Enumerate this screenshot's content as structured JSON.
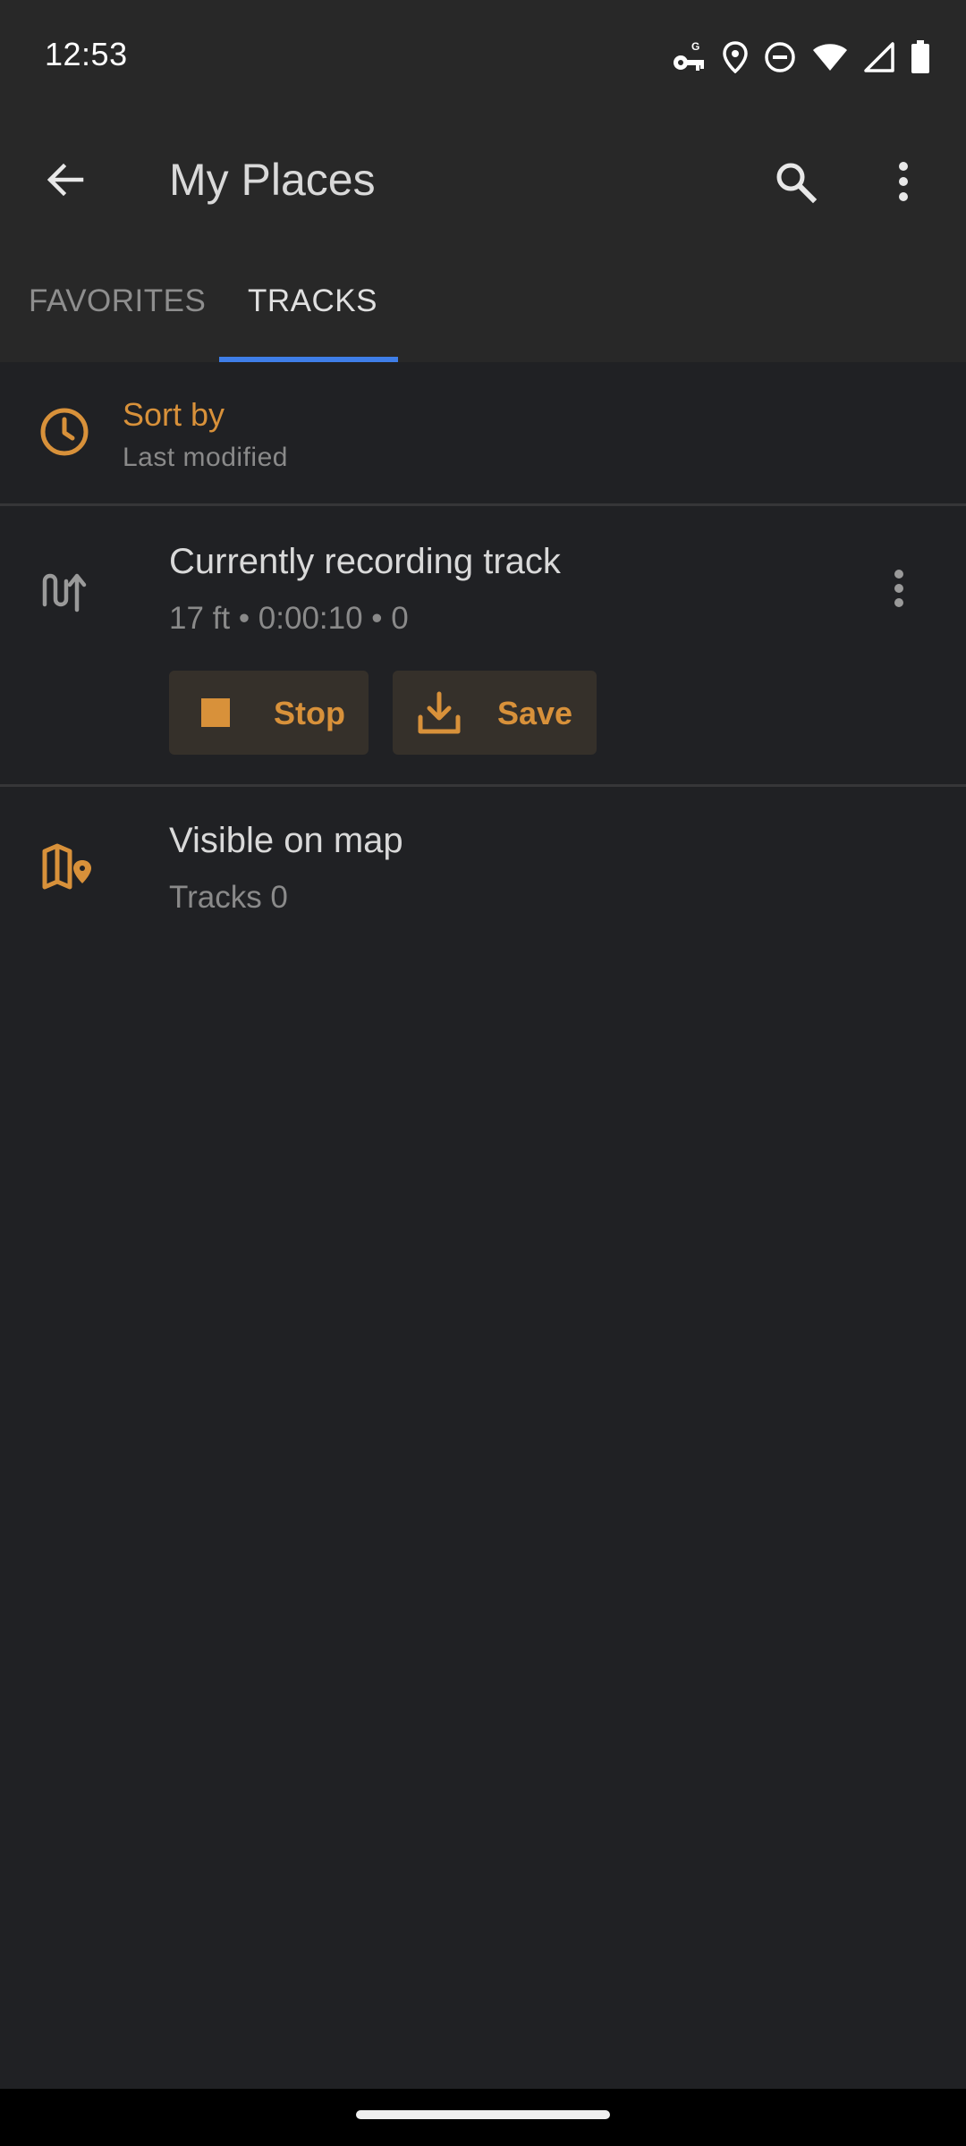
{
  "status_bar": {
    "time": "12:53",
    "icons": [
      "vpn-key-icon",
      "location-icon",
      "do-not-disturb-icon",
      "wifi-icon",
      "signal-icon",
      "battery-icon"
    ]
  },
  "app_bar": {
    "title": "My Places",
    "icons": [
      "back-arrow-icon",
      "search-icon",
      "more-vert-icon"
    ]
  },
  "tabs": [
    {
      "label": "FAVORITES",
      "selected": false
    },
    {
      "label": "TRACKS",
      "selected": true
    }
  ],
  "sort": {
    "title": "Sort by",
    "value": "Last modified",
    "icon": "clock-icon"
  },
  "recording_track": {
    "title": "Currently recording track",
    "meta": "17 ft • 0:00:10 • 0",
    "icon": "track-recording-icon",
    "stop_label": "Stop",
    "save_label": "Save"
  },
  "visible_on_map": {
    "title": "Visible on map",
    "subtitle": "Tracks 0",
    "icon": "map-pin-icon"
  },
  "colors": {
    "accent": "#d8913a",
    "tab_indicator": "#3f7ee8",
    "background": "#202124",
    "app_bar": "#282828"
  }
}
